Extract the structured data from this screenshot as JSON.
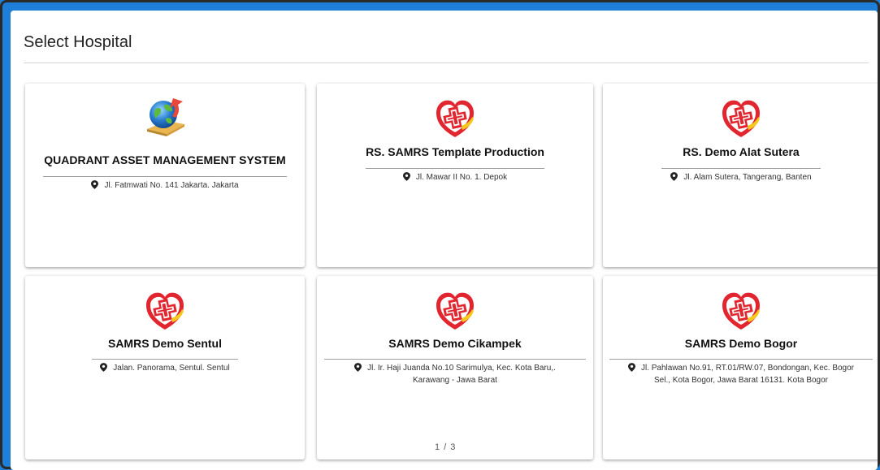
{
  "page": {
    "title": "Select Hospital",
    "pagination": "1 / 3"
  },
  "hospitals": [
    {
      "name": "QUADRANT ASSET MANAGEMENT SYSTEM",
      "address": "Jl. Fatmwati No. 141 Jakarta. Jakarta",
      "icon": "quadrant-globe-logo"
    },
    {
      "name": "RS. SAMRS Template Production",
      "address": "Jl. Mawar II No. 1. Depok",
      "icon": "samrs-cross-logo"
    },
    {
      "name": "RS. Demo Alat Sutera",
      "address": "Jl. Alam Sutera, Tangerang, Banten",
      "icon": "samrs-cross-logo"
    },
    {
      "name": "SAMRS Demo Sentul",
      "address": "Jalan. Panorama, Sentul. Sentul",
      "icon": "samrs-cross-logo"
    },
    {
      "name": "SAMRS Demo Cikampek",
      "address_line1": "Jl. Ir. Haji Juanda No.10 Sarimulya, Kec. Kota Baru,.",
      "address_line2": "Karawang - Jawa Barat",
      "icon": "samrs-cross-logo"
    },
    {
      "name": "SAMRS Demo Bogor",
      "address_line1": "Jl. Pahlawan No.91, RT.01/RW.07, Bondongan, Kec. Bogor",
      "address_line2": "Sel., Kota Bogor, Jawa Barat 16131. Kota Bogor",
      "icon": "samrs-cross-logo"
    }
  ],
  "colors": {
    "frame_blue": "#1e7fd8",
    "logo_red": "#e1262f",
    "logo_yellow": "#f5c81c"
  }
}
